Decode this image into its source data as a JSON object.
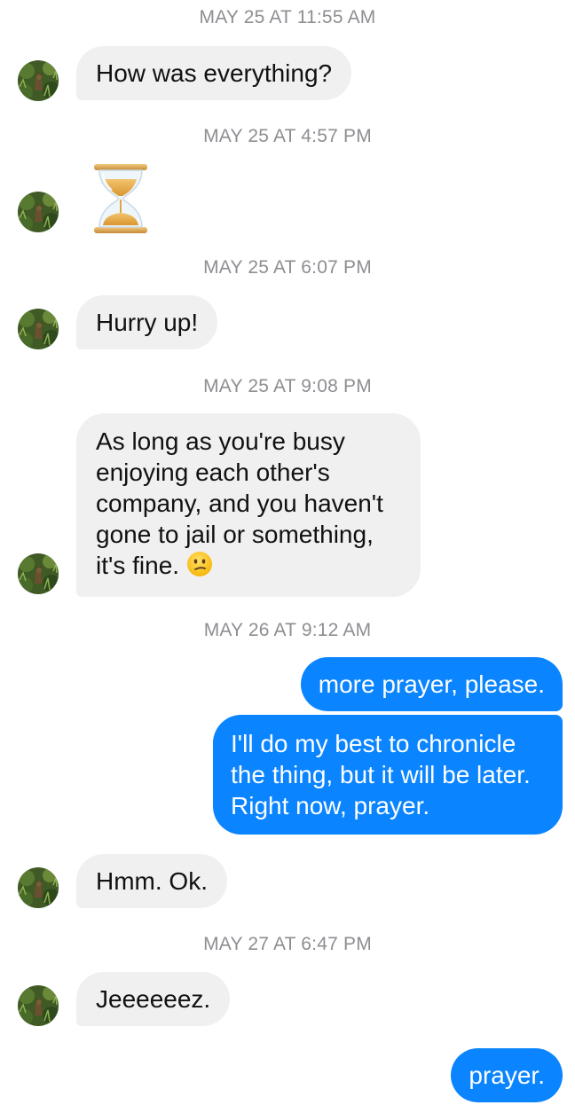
{
  "colors": {
    "incoming_bubble": "#f1f0f0",
    "outgoing_bubble": "#0a84ff",
    "timestamp": "#8e8e93"
  },
  "conversation": {
    "timestamps": [
      "MAY 25 AT 11:55 AM",
      "MAY 25 AT 4:57 PM",
      "MAY 25 AT 6:07 PM",
      "MAY 25 AT 9:08 PM",
      "MAY 26 AT 9:12 AM",
      "MAY 27 AT 6:47 PM"
    ],
    "messages": [
      {
        "sender": "contact",
        "text": "How was everything?"
      },
      {
        "sender": "contact",
        "emoji": "hourglass-icon"
      },
      {
        "sender": "contact",
        "text": "Hurry up!"
      },
      {
        "sender": "contact",
        "text": "As long as you're busy enjoying each other's company, and you haven't gone to jail or something, it's fine.",
        "emoji": "confused-face-icon"
      },
      {
        "sender": "me",
        "text": "more prayer, please."
      },
      {
        "sender": "me",
        "text": "I'll do my best to chronicle the thing, but it will be later. Right now, prayer."
      },
      {
        "sender": "contact",
        "text": "Hmm. Ok."
      },
      {
        "sender": "contact",
        "text": "Jeeeeeez."
      },
      {
        "sender": "me",
        "text": "prayer."
      }
    ]
  }
}
